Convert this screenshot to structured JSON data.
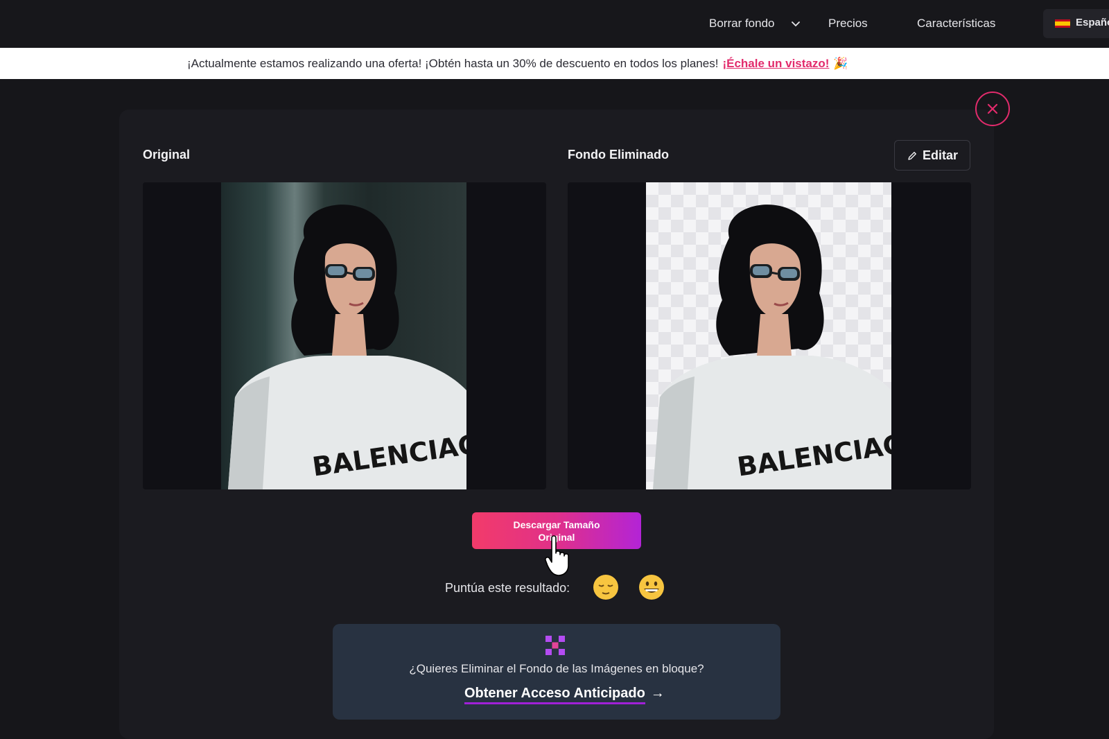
{
  "nav": {
    "items": [
      {
        "label": "Borrar fondo",
        "has_dropdown": true
      },
      {
        "label": "Precios"
      },
      {
        "label": "Características"
      }
    ],
    "language": {
      "label": "Españo",
      "flag": "spain-flag-icon"
    }
  },
  "promo": {
    "text": "¡Actualmente estamos realizando una oferta! ¡Obtén hasta un 30% de descuento en todos los planes!",
    "link": "¡Échale un vistazo!",
    "emoji": "🎉",
    "link_color": "#e22b6c"
  },
  "result": {
    "original_title": "Original",
    "removed_title": "Fondo Eliminado",
    "edit_label": "Editar",
    "shirt_text": "BALENCIAGA",
    "download_label": "Descargar Tamaño Original",
    "rate_label": "Puntúa este resultado:",
    "rating_emojis": [
      "😌",
      "😀"
    ],
    "accent": "#e22b6c"
  },
  "bulk": {
    "question": "¿Quieres Eliminar el Fondo de las Imágenes en bloque?",
    "cta": "Obtener Acceso Anticipado",
    "arrow": "→",
    "icon": "grid-logo-icon"
  }
}
